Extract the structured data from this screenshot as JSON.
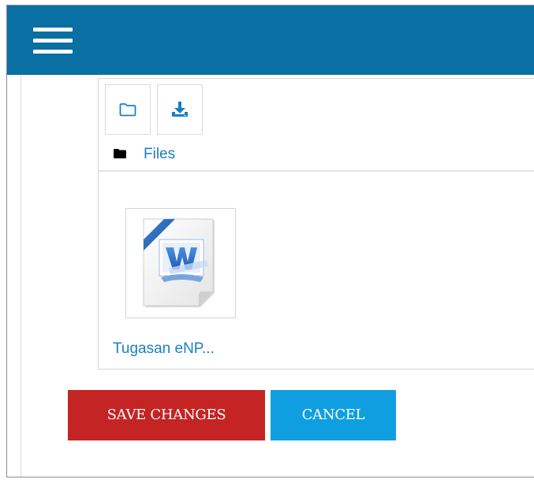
{
  "header": {
    "menu_icon": "hamburger-menu-icon",
    "background_color": "#0a6fa3"
  },
  "filemanager": {
    "toolbar": {
      "create_folder_icon": "folder-outline-icon",
      "download_icon": "download-icon"
    },
    "path": {
      "icon": "folder-solid-icon",
      "label": "Files"
    },
    "files": [
      {
        "name": "Tugasan eNP...",
        "icon": "word-document-icon"
      }
    ]
  },
  "actions": {
    "save_label": "SAVE CHANGES",
    "save_color": "#c42423",
    "cancel_label": "CANCEL",
    "cancel_color": "#0f9fe0"
  }
}
